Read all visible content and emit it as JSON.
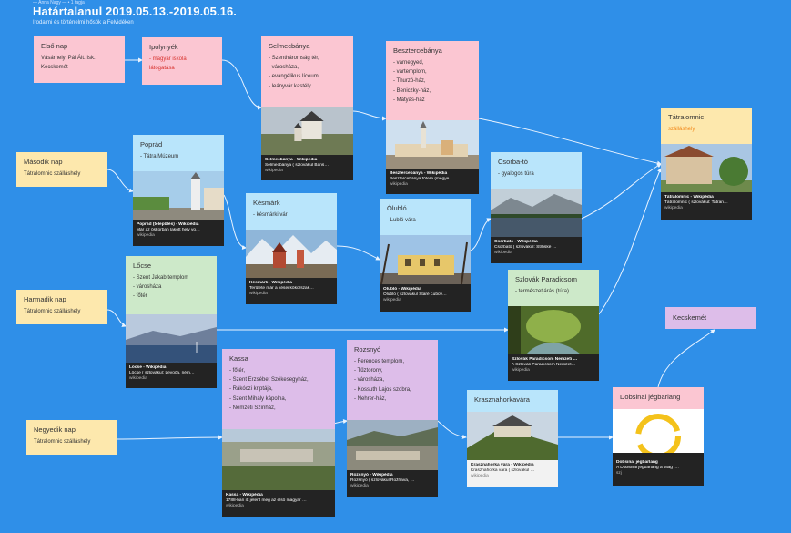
{
  "header": {
    "top_line": "— Anna Nagy — • 1 tagja",
    "title": "Határtalanul 2019.05.13.-2019.05.16.",
    "subtitle": "Irodalmi és történelmi hősök a Felvidéken"
  },
  "day1": {
    "title": "Első nap",
    "items": [
      "Vásárhelyi Pál Ált. Isk.",
      "Kecskemét"
    ]
  },
  "ipolynyek": {
    "title": "Ipolynyék",
    "items": [
      "- magyar iskola",
      "látogatása"
    ]
  },
  "selmecbanya": {
    "title": "Selmecbánya",
    "items": [
      "- Szentháromság tér,",
      "- városháza,",
      "- evangélikus líceum,",
      "- leányvár kastély"
    ],
    "cap_title": "Selmecbánya - Wikipédia",
    "cap_desc": "Selmecbánya ( szlovákul Bans…",
    "cap_site": "wikipedia"
  },
  "besztercebanya": {
    "title": "Besztercebánya",
    "items": [
      "- várnegyed,",
      "- vártemplom,",
      "- Thurzó-ház,",
      "- Beniczky-ház,",
      "- Mátyás-ház"
    ],
    "cap_title": "Besztercebánya - Wikipédia",
    "cap_desc": "Besztercebánya főtere (megye…",
    "cap_site": "wikipedia"
  },
  "tatralomnic": {
    "title": "Tátralomnic",
    "subtitle": "szálláshely",
    "cap_title": "Tátralomnic - Wikipédia",
    "cap_desc": "Tátralomnic ( szlovákul: Tatran…",
    "cap_site": "wikipedia"
  },
  "day2": {
    "title": "Második nap",
    "items": [
      "Tátralomnic szálláshely"
    ]
  },
  "poprad": {
    "title": "Poprád",
    "items": [
      "- Tátra Múzeum"
    ],
    "cap_title": "Poprád (település) - Wikipédia",
    "cap_desc": "Már az őskorban lakott hely vo…",
    "cap_site": "wikipedia"
  },
  "kesmark": {
    "title": "Késmárk",
    "items": [
      "- késmárki vár"
    ],
    "cap_title": "Késmárk - Wikipédia",
    "cap_desc": "Területe már a kései kőkorszak…",
    "cap_site": "wikipedia"
  },
  "olublo": {
    "title": "Ólubló",
    "items": [
      "- Lubló vára"
    ],
    "cap_title": "Ólubló - Wikipédia",
    "cap_desc": "Ólubló ( szlovákul Staré Ľubov…",
    "cap_site": "wikipedia"
  },
  "csorbato": {
    "title": "Csorba-tó",
    "items": [
      "- gyalogos túra"
    ],
    "cap_title": "Csorbató - Wikipédia",
    "cap_desc": "Csorbató ( szlovákul: Štrbské …",
    "cap_site": "wikipedia"
  },
  "locse": {
    "title": "Lőcse",
    "items": [
      "- Szent Jakab templom",
      "- városháza",
      "- főtér"
    ],
    "cap_title": "Lőcse - Wikipédia",
    "cap_desc": "Lőcse ( szlovákul: Levoča, ném…",
    "cap_site": "wikipedia"
  },
  "day3": {
    "title": "Harmadik nap",
    "items": [
      "Tátralomnic szálláshely"
    ]
  },
  "szlovakparadicsom": {
    "title": "Szlovák Paradicsom",
    "items": [
      "- természetjárás (túra)"
    ],
    "cap_title": "Szlovák Paradicsom Nemzeti …",
    "cap_desc": "A Szlovák Paradicsom Nemzet…",
    "cap_site": "wikipedia"
  },
  "kecskemet": {
    "title": "Kecskemét"
  },
  "kassa": {
    "title": "Kassa",
    "items": [
      "- főtér,",
      "- Szent Erzsébet Székesegyház,",
      "- Rákóczi kriptája,",
      "- Szent Mihály kápolna,",
      "- Nemzeti Színház,"
    ],
    "cap_title": "Kassa - Wikipédia",
    "cap_desc": "1788-ban itt jelent meg az első magyar …",
    "cap_site": "wikipedia"
  },
  "rozsnyo": {
    "title": "Rozsnyó",
    "items": [
      "- Ferences templom,",
      "- Tűztorony,",
      "- városháza,",
      "- Kossuth Lajos szobra,",
      "- Nehrer-ház,"
    ],
    "cap_title": "Rozsnyó - Wikipédia",
    "cap_desc": "Rozsnyó ( szlovákul Rožňava, …",
    "cap_site": "wikipedia"
  },
  "krasznahorkavara": {
    "title": "Krasznahorkavára",
    "cap_title": "Krasznahorka vára - Wikipédia",
    "cap_desc": "Krasznahorka vára ( szlovákul …",
    "cap_site": "wikipedia"
  },
  "dobsinai": {
    "title": "Dobsinai jégbarlang",
    "cap_title": "Dobsinai jégbarlang",
    "cap_desc": "A Dobsinai jégbarlang a világ l…",
    "cap_site": "szj"
  },
  "day4": {
    "title": "Negyedik nap",
    "items": [
      "Tátralomnic szálláshely"
    ]
  },
  "colors": {
    "background": "#2f8fe8",
    "pink": "#fbc6d2",
    "blue": "#b9e5fb",
    "green": "#cde9c9",
    "purple": "#ddbde9",
    "yellow": "#fde8ad",
    "accent_red": "#d8322e",
    "accent_orange": "#f28a1b"
  }
}
